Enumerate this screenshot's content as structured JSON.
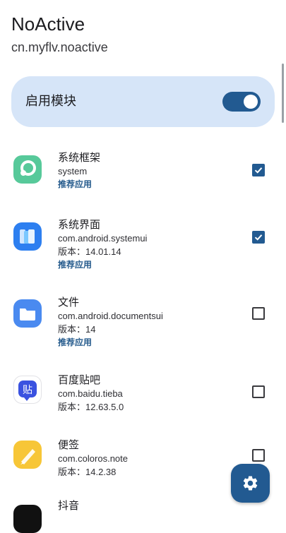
{
  "header": {
    "title": "NoActive",
    "package": "cn.myflv.noactive"
  },
  "module": {
    "label": "启用模块",
    "enabled": true
  },
  "apps": [
    {
      "name": "系统框架",
      "package": "system",
      "tag": "推荐应用",
      "checked": true
    },
    {
      "name": "系统界面",
      "package": "com.android.systemui",
      "version": "版本：14.01.14",
      "tag": "推荐应用",
      "checked": true
    },
    {
      "name": "文件",
      "package": "com.android.documentsui",
      "version": "版本：14",
      "tag": "推荐应用",
      "checked": false
    },
    {
      "name": "百度贴吧",
      "package": "com.baidu.tieba",
      "version": "版本：12.63.5.0",
      "checked": false
    },
    {
      "name": "便签",
      "package": "com.coloros.note",
      "version": "版本：14.2.38",
      "checked": false
    },
    {
      "name": "抖音",
      "checked": false
    }
  ],
  "icons": {
    "system_framework": "android-system-framework-icon",
    "system_ui": "system-ui-icon",
    "files": "folder-icon",
    "tieba": "tieba-icon",
    "notes": "notes-icon",
    "douyin": "douyin-icon",
    "fab": "settings-gear-icon"
  },
  "colors": {
    "accent": "#225a91",
    "card": "#d6e5f8",
    "tag": "#245a8c"
  }
}
